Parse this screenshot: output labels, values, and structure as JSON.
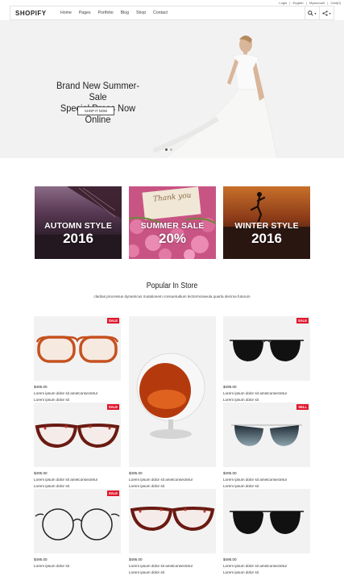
{
  "topbar": {
    "login": "Login",
    "sep1": "|",
    "lang": "English",
    "sep2": "|",
    "account": "Myaccount",
    "sep3": "|",
    "cart": "Cart(0)"
  },
  "nav": {
    "logo": "SHOPIFY",
    "menu": [
      "Home",
      "Pages",
      "Portfolio",
      "Blog",
      "Shop",
      "Contact"
    ],
    "search_icon": "search-icon",
    "share_icon": "share-icon"
  },
  "hero": {
    "line1": "Brand New Summer-Sale",
    "line2": "Special Dress Now Online",
    "button": "SHOP IT NOW"
  },
  "banners": [
    {
      "title": "AUTOMN STYLE",
      "year": "2016"
    },
    {
      "title": "SUMMER SALE",
      "year": "20%",
      "overlay_text": "Thank you"
    },
    {
      "title": "WINTER STYLE",
      "year": "2016"
    }
  ],
  "popular": {
    "title": "Popular In Store",
    "subtitle": "claritas processus dynamicus mutationem consuetudium lectormoraeula quarta decima futurum"
  },
  "products": [
    {
      "badge": "SALE",
      "price": "$495.00",
      "line1": "Lorem ipsum dolor sit ametconsectetur",
      "line2": "Lorem ipsum dolor sit"
    },
    {
      "badge": "",
      "price": "$495.00",
      "line1": "Lorem ipsum dolor sit ametconsectetur",
      "line2": "Lorem ipsum dolor sit"
    },
    {
      "badge": "SALE",
      "price": "$495.00",
      "line1": "Lorem ipsum dolor sit ametconsectetur",
      "line2": "Lorem ipsum dolor sit"
    },
    {
      "badge": "SALE",
      "price": "$495.00",
      "line1": "Lorem ipsum dolor sit ametconsectetur",
      "line2": "Lorem ipsum dolor sit"
    },
    {
      "badge": "SELL",
      "price": "$495.00",
      "line1": "Lorem ipsum dolor sit ametconsectetur",
      "line2": "Lorem ipsum dolor sit"
    },
    {
      "badge": "SALE",
      "price": "$495.00",
      "line1": "Lorem ipsum dolor sit"
    },
    {
      "badge": "",
      "price": "$495.00",
      "line1": "Lorem ipsum dolor sit ametconsectetur",
      "line2": "Lorem ipsum dolor sit"
    },
    {
      "badge": "",
      "price": "$495.00",
      "line1": "Lorem ipsum dolor sit ametconsectetur",
      "line2": "Lorem ipsum dolor sit"
    }
  ],
  "colors": {
    "sale_badge": "#e0162b",
    "hero_bg": "#f2f2f2"
  }
}
